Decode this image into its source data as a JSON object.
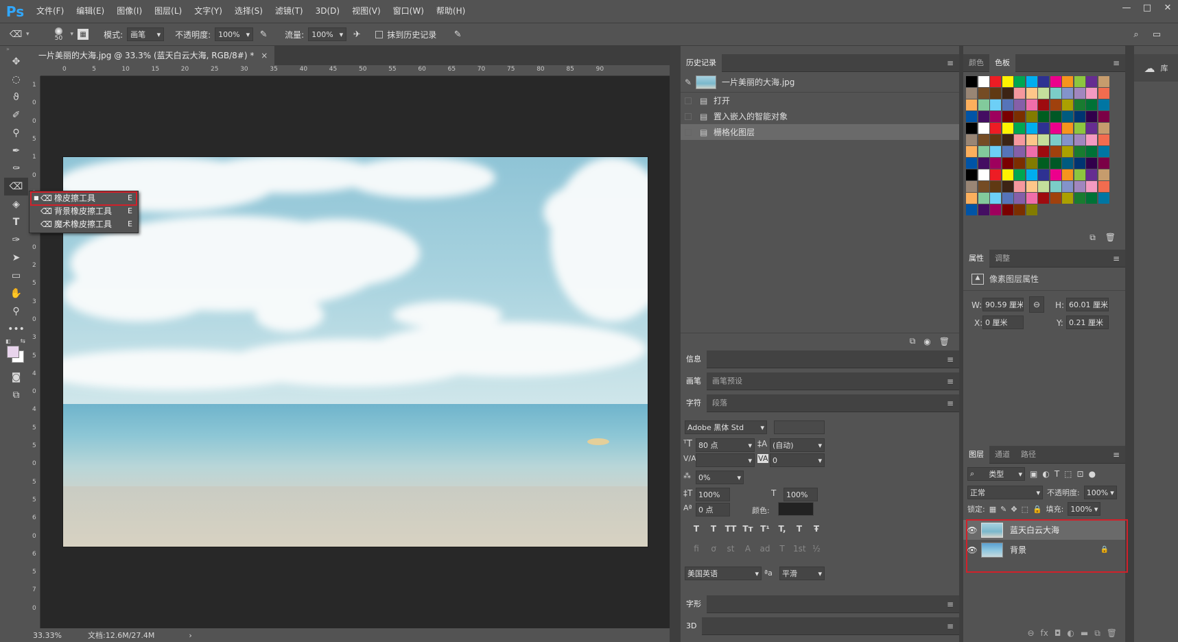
{
  "menubar": {
    "logo": "Ps",
    "items": [
      "文件(F)",
      "编辑(E)",
      "图像(I)",
      "图层(L)",
      "文字(Y)",
      "选择(S)",
      "滤镜(T)",
      "3D(D)",
      "视图(V)",
      "窗口(W)",
      "帮助(H)"
    ],
    "window_controls": [
      "—",
      "□",
      "✕"
    ]
  },
  "options": {
    "brush_size": "50",
    "mode_label": "模式:",
    "mode_value": "画笔",
    "opacity_label": "不透明度:",
    "opacity_value": "100%",
    "flow_label": "流量:",
    "flow_value": "100%",
    "erase_history_label": "抹到历史记录"
  },
  "document": {
    "tab_title": "一片美丽的大海.jpg @ 33.3% (蓝天白云大海, RGB/8#) *",
    "close": "×",
    "zoom": "33.33%",
    "doc_size": "文档:12.6M/27.4M",
    "status_arrow": "›"
  },
  "ruler": {
    "h": [
      "0",
      "5",
      "10",
      "15",
      "20",
      "25",
      "30",
      "35",
      "40",
      "45",
      "50",
      "55",
      "60",
      "65",
      "70",
      "75",
      "80",
      "85",
      "90"
    ],
    "v": [
      "1",
      "0",
      "0",
      "5",
      "1",
      "0",
      "1",
      "5",
      "2",
      "0",
      "2",
      "5",
      "3",
      "0",
      "3",
      "5",
      "4",
      "0",
      "4",
      "5",
      "5",
      "0",
      "5",
      "5",
      "6",
      "0",
      "6",
      "5",
      "7",
      "0"
    ]
  },
  "flyout": {
    "items": [
      {
        "label": "橡皮擦工具",
        "key": "E"
      },
      {
        "label": "背景橡皮擦工具",
        "key": "E"
      },
      {
        "label": "魔术橡皮擦工具",
        "key": "E"
      }
    ]
  },
  "history": {
    "tab": "历史记录",
    "snapshot": "一片美丽的大海.jpg",
    "items": [
      "打开",
      "置入嵌入的智能对象",
      "栅格化图层"
    ]
  },
  "swatches": {
    "tabs": [
      "颜色",
      "色板"
    ],
    "colors": [
      "#000000",
      "#ffffff",
      "#ed1c24",
      "#fff200",
      "#00a651",
      "#00aeef",
      "#2e3192",
      "#ec008c",
      "#f7941d",
      "#8dc63f",
      "#662d91",
      "#c69c6d",
      "#998675",
      "#754c24",
      "#603913",
      "#3c2415",
      "#f5989d",
      "#fdc689",
      "#c4df9b",
      "#7bcdc8",
      "#8393ca",
      "#a186be",
      "#f49ac1",
      "#f26c4f",
      "#fbaf5d",
      "#82ca9c",
      "#6dcff6",
      "#5674b9",
      "#855fa8",
      "#f06eaa",
      "#9e0b0f",
      "#a0410d",
      "#aba000",
      "#197b30",
      "#007236",
      "#0076a3",
      "#0054a6",
      "#440e62",
      "#9e005d",
      "#790000",
      "#7b2e00",
      "#827b00",
      "#005e20",
      "#005826",
      "#005b7f",
      "#003471",
      "#32004b",
      "#7b0046"
    ]
  },
  "properties": {
    "tabs": [
      "属性",
      "调整"
    ],
    "title": "像素图层属性",
    "w_label": "W:",
    "w_value": "90.59 厘米",
    "h_label": "H:",
    "h_value": "60.01 厘米",
    "x_label": "X:",
    "x_value": "0 厘米",
    "y_label": "Y:",
    "y_value": "0.21 厘米"
  },
  "collapsed": {
    "info": "信息",
    "brush": "画笔",
    "brush_preset": "画笔预设",
    "glyph": "字形",
    "three_d": "3D"
  },
  "character": {
    "tabs": [
      "字符",
      "段落"
    ],
    "font": "Adobe 黑体 Std",
    "size": "80 点",
    "leading": "(自动)",
    "tracking": "0",
    "scale_pct": "0%",
    "vscale": "100%",
    "hscale": "100%",
    "baseline": "0 点",
    "color_label": "颜色:",
    "language": "美国英语",
    "aa_label": "ªa",
    "aa": "平滑",
    "style_btns": [
      "T",
      "T",
      "TT",
      "Tт",
      "T¹",
      "T,",
      "T",
      "Ŧ"
    ],
    "ot_btns": [
      "fi",
      "ơ",
      "st",
      "A",
      "ad",
      "T",
      "1st",
      "½"
    ]
  },
  "layers": {
    "tabs": [
      "图层",
      "通道",
      "路径"
    ],
    "filter": "类型",
    "blend": "正常",
    "opacity_label": "不透明度:",
    "opacity": "100%",
    "lock_label": "锁定:",
    "fill_label": "填充:",
    "fill": "100%",
    "items": [
      {
        "name": "蓝天白云大海"
      },
      {
        "name": "背景"
      }
    ]
  },
  "library": {
    "label": "库"
  }
}
